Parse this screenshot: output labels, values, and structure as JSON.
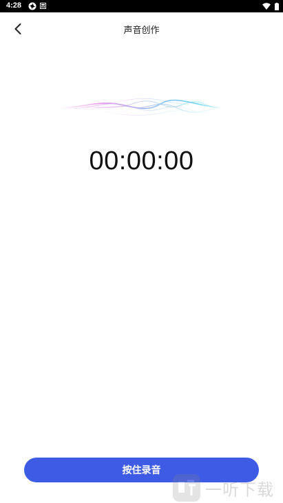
{
  "status_bar": {
    "time": "4:28",
    "icons": [
      "sync-icon",
      "sim-icon",
      "wifi-icon",
      "battery-icon"
    ]
  },
  "header": {
    "title": "声音创作",
    "back_icon": "chevron-left-icon"
  },
  "recorder": {
    "timer": "00:00:00",
    "waveform_colors": [
      "#e28be8",
      "#7fb8f0",
      "#5fd3f2"
    ]
  },
  "record_button": {
    "label": "按住录音",
    "color": "#3e5be6"
  },
  "watermark": {
    "text": "一听下载"
  }
}
